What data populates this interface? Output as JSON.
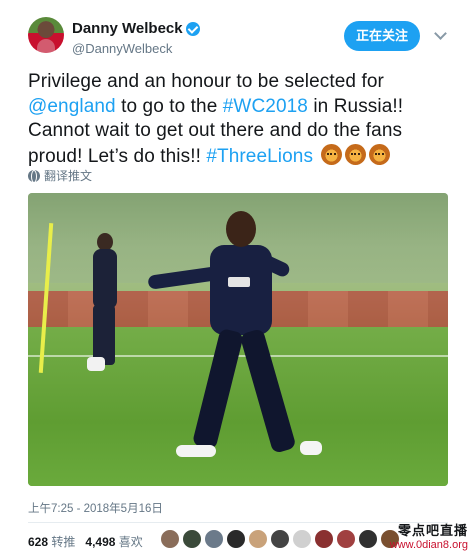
{
  "header": {
    "display_name": "Danny Welbeck",
    "handle": "@DannyWelbeck",
    "follow_label": "正在关注"
  },
  "tweet": {
    "line1": "Privilege and an honour to be selected for",
    "mention": "@england",
    "mid1": " to go to the ",
    "hashtag1": "#WC2018",
    "mid2": " in Russia!! Cannot wait to get out there and do the fans proud! Let’s do this!! ",
    "hashtag2": "#ThreeLions",
    "emojis": [
      "lion-face-emoji",
      "lion-face-emoji",
      "lion-face-emoji"
    ],
    "translate_label": "翻译推文"
  },
  "meta": {
    "timestamp": "上午7:25 - 2018年5月16日"
  },
  "stats": {
    "retweet_count": "628",
    "retweet_label": "转推",
    "like_count": "4,498",
    "like_label": "喜欢"
  },
  "likers": [
    "#8a6d5a",
    "#3b4a3a",
    "#6b7a8a",
    "#2a2a2a",
    "#c9a27a",
    "#444444",
    "#d0d0d0",
    "#8a3030",
    "#a04040",
    "#303030",
    "#7a5030"
  ],
  "watermark": {
    "title": "零点吧直播",
    "url": "www.0dian8.org"
  },
  "colors": {
    "accent": "#1da1f2",
    "text": "#14171a",
    "muted": "#657786"
  }
}
